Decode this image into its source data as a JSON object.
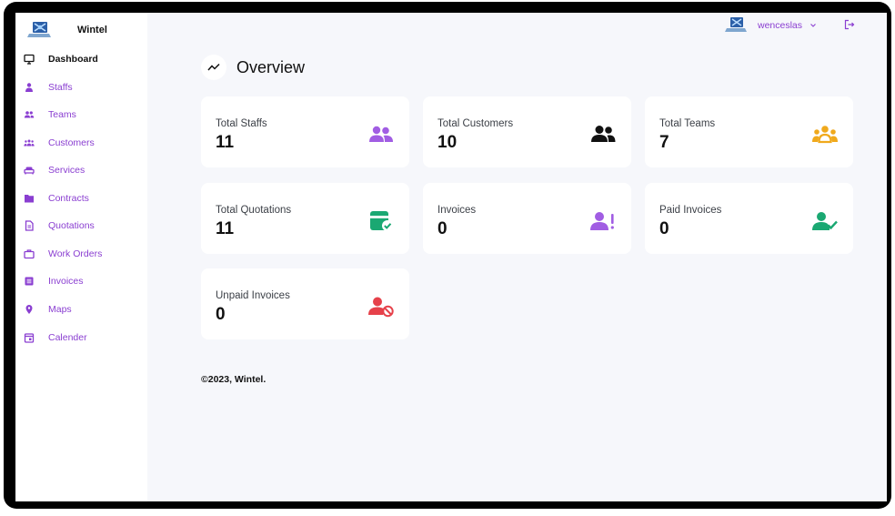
{
  "brand": {
    "name": "Wintel",
    "logo_icon": "laptop-logo-icon"
  },
  "sidebar": {
    "items": [
      {
        "label": "Dashboard",
        "icon": "monitor-icon",
        "active": true
      },
      {
        "label": "Staffs",
        "icon": "user-tie-icon"
      },
      {
        "label": "Teams",
        "icon": "users-icon"
      },
      {
        "label": "Customers",
        "icon": "people-group-icon"
      },
      {
        "label": "Services",
        "icon": "couch-icon"
      },
      {
        "label": "Contracts",
        "icon": "folder-icon"
      },
      {
        "label": "Quotations",
        "icon": "file-icon"
      },
      {
        "label": "Work Orders",
        "icon": "briefcase-icon"
      },
      {
        "label": "Invoices",
        "icon": "list-icon"
      },
      {
        "label": "Maps",
        "icon": "map-pin-icon"
      },
      {
        "label": "Calender",
        "icon": "calendar-icon"
      }
    ]
  },
  "header": {
    "user_name": "wenceslas"
  },
  "overview": {
    "title": "Overview"
  },
  "cards": [
    {
      "label": "Total Staffs",
      "value": "11",
      "icon": "users-icon",
      "color": "#a15de3"
    },
    {
      "label": "Total Customers",
      "value": "10",
      "icon": "user-group-icon",
      "color": "#111111"
    },
    {
      "label": "Total Teams",
      "value": "7",
      "icon": "people-group-icon",
      "color": "#f0a91c"
    },
    {
      "label": "Total Quotations",
      "value": "11",
      "icon": "document-check-icon",
      "color": "#1aa872"
    },
    {
      "label": "Invoices",
      "value": "0",
      "icon": "user-exclamation-icon",
      "color": "#a15de3"
    },
    {
      "label": "Paid Invoices",
      "value": "0",
      "icon": "user-check-icon",
      "color": "#1aa872"
    },
    {
      "label": "Unpaid Invoices",
      "value": "0",
      "icon": "user-block-icon",
      "color": "#e6414a"
    }
  ],
  "footer": {
    "text": "©2023, Wintel."
  },
  "colors": {
    "accent": "#8a3ed1",
    "background": "#f6f7fb"
  }
}
